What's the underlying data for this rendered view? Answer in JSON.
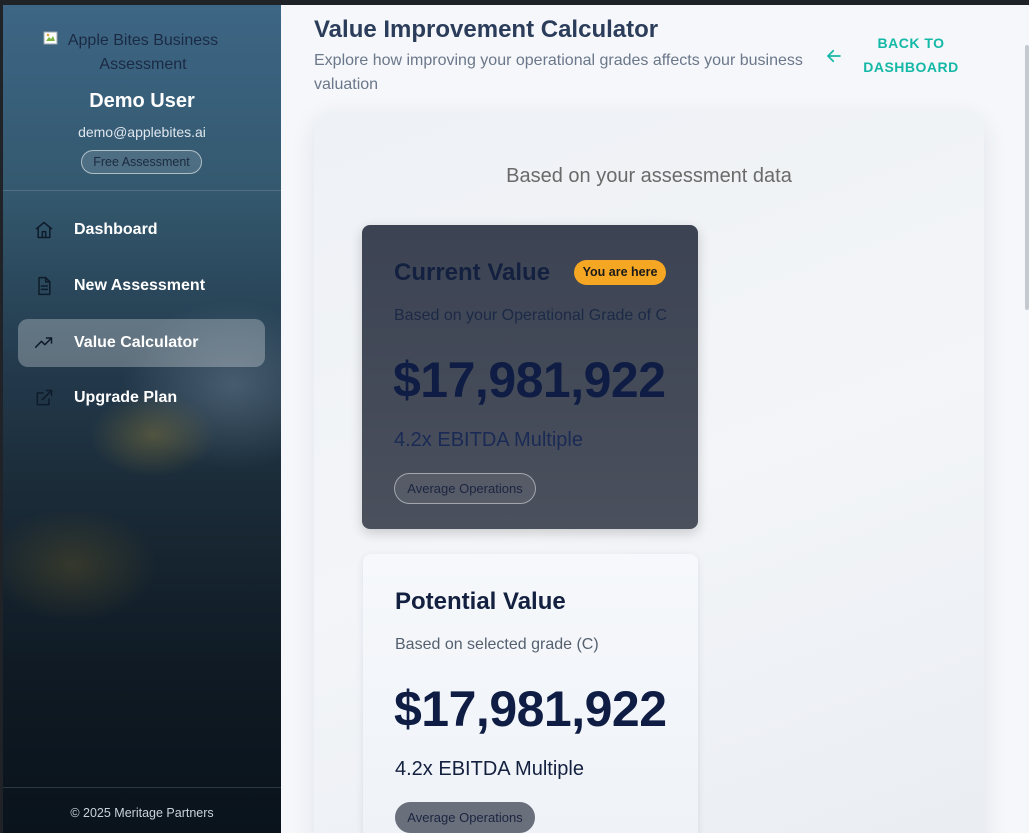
{
  "sidebar": {
    "logo_alt": "Apple Bites Business Assessment",
    "user": {
      "name": "Demo User",
      "email": "demo@applebites.ai",
      "plan": "Free Assessment"
    },
    "nav": [
      {
        "label": "Dashboard",
        "icon": "home-icon",
        "active": false
      },
      {
        "label": "New Assessment",
        "icon": "document-icon",
        "active": false
      },
      {
        "label": "Value Calculator",
        "icon": "trending-up-icon",
        "active": true
      },
      {
        "label": "Upgrade Plan",
        "icon": "external-link-icon",
        "active": false
      }
    ],
    "footer": "© 2025 Meritage Partners"
  },
  "header": {
    "title": "Value Improvement Calculator",
    "subtitle": "Explore how improving your operational grades affects your business valuation",
    "back_label": "BACK TO DASHBOARD"
  },
  "calculator": {
    "caption": "Based on your assessment data",
    "current": {
      "title": "Current Value",
      "badge": "You are here",
      "subtitle": "Based on your Operational Grade of C",
      "value": "$17,981,922",
      "multiple": "4.2x EBITDA Multiple",
      "ops_label": "Average Operations"
    },
    "potential": {
      "title": "Potential Value",
      "subtitle": "Based on selected grade (C)",
      "value": "$17,981,922",
      "multiple": "4.2x EBITDA Multiple",
      "ops_label": "Average Operations"
    }
  },
  "colors": {
    "accent_teal": "#14b8a6",
    "badge_orange": "#f5a623",
    "title_navy": "#2b3d5a",
    "value_navy": "#0f1d44"
  }
}
